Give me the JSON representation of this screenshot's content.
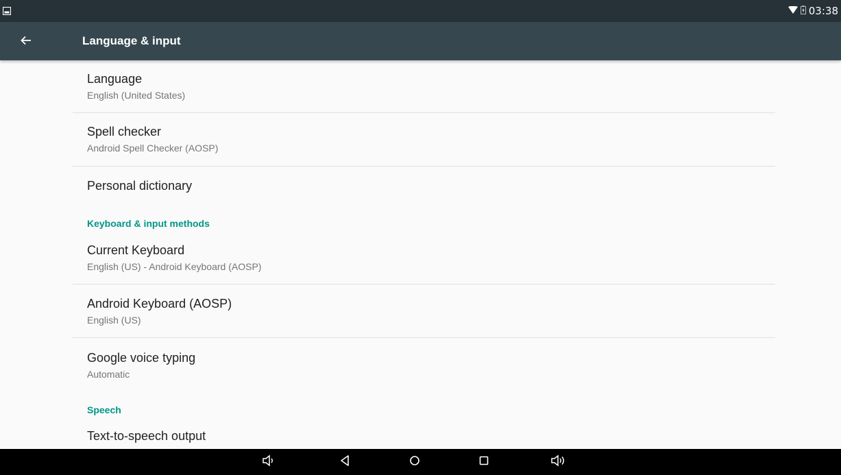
{
  "status_bar": {
    "left_icon": "image-notification-icon",
    "wifi_icon": "wifi-icon",
    "battery_icon": "battery-charging-icon",
    "time": "03:38"
  },
  "app_bar": {
    "back_icon": "arrow-back-icon",
    "title": "Language & input"
  },
  "preferences": [
    {
      "title": "Language",
      "summary": "English (United States)"
    },
    {
      "title": "Spell checker",
      "summary": "Android Spell Checker (AOSP)"
    },
    {
      "title": "Personal dictionary"
    }
  ],
  "category_keyboard": "Keyboard & input methods",
  "keyboard_prefs": [
    {
      "title": "Current Keyboard",
      "summary": "English (US) - Android Keyboard (AOSP)"
    },
    {
      "title": "Android Keyboard (AOSP)",
      "summary": "English (US)"
    },
    {
      "title": "Google voice typing",
      "summary": "Automatic"
    }
  ],
  "category_speech": "Speech",
  "speech_prefs": [
    {
      "title": "Text-to-speech output"
    }
  ],
  "nav_bar": {
    "icons": [
      "volume-down-icon",
      "back-triangle-icon",
      "home-circle-icon",
      "recents-square-icon",
      "volume-up-icon"
    ]
  },
  "colors": {
    "status_bar": "#263238",
    "app_bar": "#37474f",
    "accent": "#009688",
    "background": "#fafafa"
  }
}
